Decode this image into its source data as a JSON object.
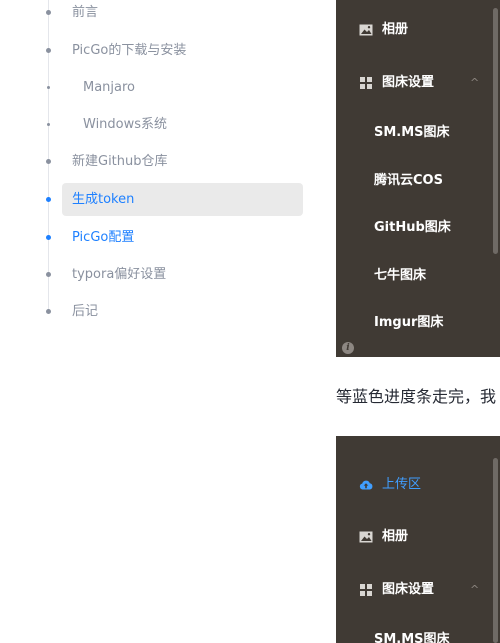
{
  "toc": {
    "items": [
      {
        "label": "前言"
      },
      {
        "label": "PicGo的下载与安装"
      },
      {
        "label": "Manjaro"
      },
      {
        "label": "Windows系统"
      },
      {
        "label": "新建Github仓库"
      },
      {
        "label": "生成token"
      },
      {
        "label": "PicGo配置"
      },
      {
        "label": "typora偏好设置"
      },
      {
        "label": "后记"
      }
    ],
    "active_color": "#1e80ff"
  },
  "screenshot1": {
    "menu": [
      {
        "label": "相册",
        "icon": "image-icon"
      },
      {
        "label": "图床设置",
        "icon": "grid-icon",
        "chevron": "^"
      },
      {
        "label": "SM.MS图床"
      },
      {
        "label": "腾讯云COS"
      },
      {
        "label": "GitHub图床"
      },
      {
        "label": "七牛图床"
      },
      {
        "label": "Imgur图床"
      }
    ],
    "info_glyph": "i"
  },
  "body_text": "等蓝色进度条走完，我",
  "screenshot2": {
    "menu": [
      {
        "label": "上传区",
        "icon": "cloud-upload-icon"
      },
      {
        "label": "相册",
        "icon": "image-icon"
      },
      {
        "label": "图床设置",
        "icon": "grid-icon",
        "chevron": "^"
      },
      {
        "label": "SM.MS图床"
      }
    ]
  }
}
